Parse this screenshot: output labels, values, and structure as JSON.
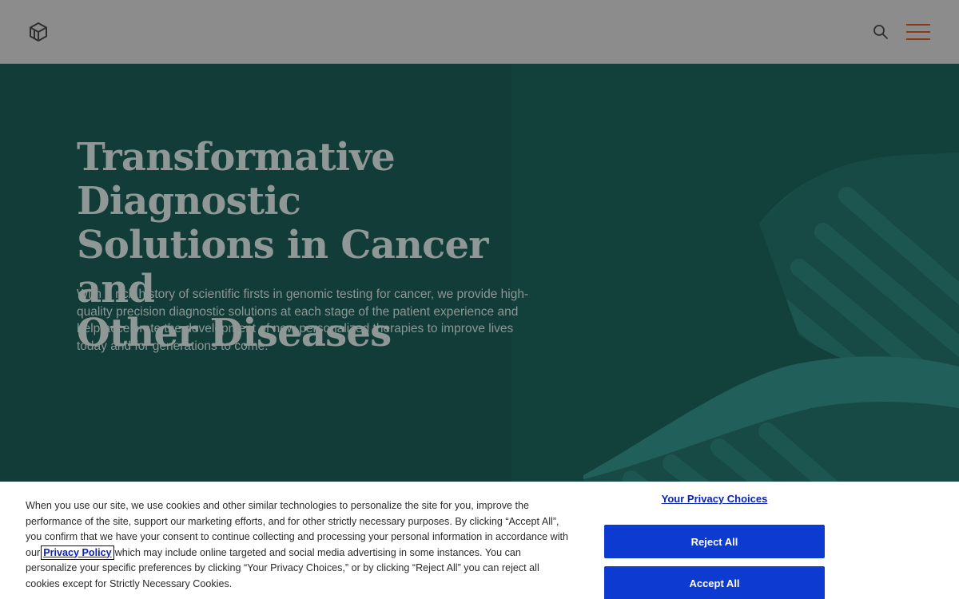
{
  "header": {
    "logo_icon": "cube-logo-icon",
    "search_icon": "search-icon",
    "menu_icon": "hamburger-menu-icon"
  },
  "hero": {
    "title_line1": "Transformative Diagnostic",
    "title_line2": "Solutions in Cancer and",
    "title_line3": "Other Diseases",
    "body": "With a rich history of scientific firsts in genomic testing for cancer, we provide high-quality precision diagnostic solutions at each stage of the patient experience and help accelerate the development of new personalized therapies to improve lives today and for generations to come."
  },
  "cookie_banner": {
    "text_before_link": "When you use our site, we use cookies and other similar technologies to personalize the site for you, improve the performance of the site, support our marketing efforts, and for other strictly necessary purposes. By clicking “Accept All”, you confirm that we have your consent to continue collecting and processing your personal information in accordance with our",
    "privacy_link": "Privacy Policy",
    "text_after_link": "which may include online targeted and social media advertising in some instances. You can personalize your specific preferences by clicking “Your Privacy Choices,” or by clicking “Reject All” you can reject all cookies except for Strictly Necessary Cookies.",
    "privacy_choices": "Your Privacy Choices",
    "reject_label": "Reject All",
    "accept_label": "Accept All"
  },
  "colors": {
    "header_bg": "#8c8c8c",
    "hero_bg": "#123c38",
    "button_blue": "#0d3ad0",
    "link_blue": "#0a22b8",
    "menu_accent": "#8a3a1c"
  }
}
